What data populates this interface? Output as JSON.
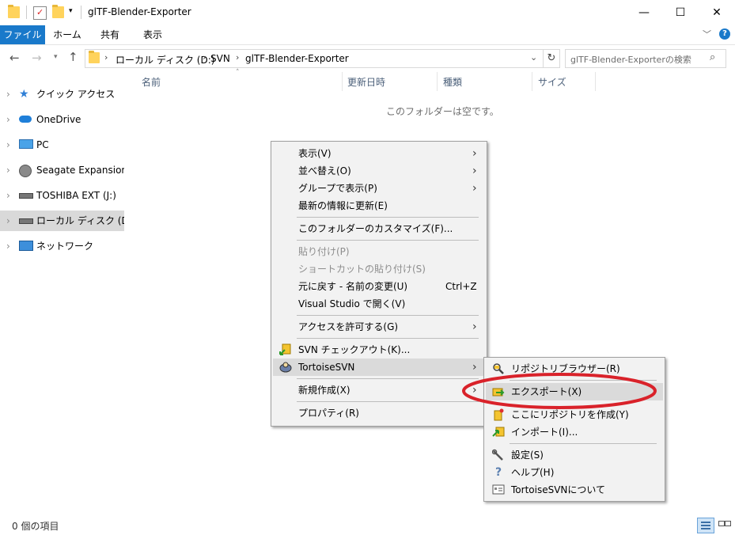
{
  "window": {
    "title": "glTF-Blender-Exporter",
    "minimize": "—",
    "maximize": "☐",
    "close": "✕"
  },
  "ribbon": {
    "tabs": [
      "ファイル",
      "ホーム",
      "共有",
      "表示"
    ],
    "accent": "#1979ca"
  },
  "address": {
    "breadcrumb": [
      "ローカル ディスク (D:)",
      "SVN",
      "glTF-Blender-Exporter"
    ],
    "search_placeholder": "glTF-Blender-Exporterの検索"
  },
  "nav": {
    "items": [
      {
        "label": "クイック アクセス",
        "icon": "star-icon"
      },
      {
        "label": "OneDrive",
        "icon": "cloud-icon"
      },
      {
        "label": "PC",
        "icon": "monitor-icon"
      },
      {
        "label": "Seagate Expansion Drive",
        "icon": "drive-icon"
      },
      {
        "label": "TOSHIBA EXT (J:)",
        "icon": "usb-drive-icon"
      },
      {
        "label": "ローカル ディスク (D:)",
        "icon": "disk-icon",
        "selected": true
      },
      {
        "label": "ネットワーク",
        "icon": "network-icon"
      }
    ]
  },
  "columns": [
    "名前",
    "更新日時",
    "種類",
    "サイズ"
  ],
  "empty_message": "このフォルダーは空です。",
  "status": {
    "count": "0 個の項目"
  },
  "context_menu": {
    "items": [
      {
        "label": "表示(V)",
        "submenu": true
      },
      {
        "label": "並べ替え(O)",
        "submenu": true
      },
      {
        "label": "グループで表示(P)",
        "submenu": true
      },
      {
        "label": "最新の情報に更新(E)"
      },
      {
        "label": "このフォルダーのカスタマイズ(F)..."
      },
      {
        "label": "貼り付け(P)",
        "disabled": true
      },
      {
        "label": "ショートカットの貼り付け(S)",
        "disabled": true
      },
      {
        "label": "元に戻す - 名前の変更(U)",
        "shortcut": "Ctrl+Z"
      },
      {
        "label": "Visual Studio で開く(V)"
      },
      {
        "label": "アクセスを許可する(G)",
        "submenu": true
      },
      {
        "label": "SVN チェックアウト(K)...",
        "icon": "svn-checkout-icon"
      },
      {
        "label": "TortoiseSVN",
        "icon": "tortoise-icon",
        "submenu": true,
        "highlighted": true
      },
      {
        "label": "新規作成(X)",
        "submenu": true
      },
      {
        "label": "プロパティ(R)"
      }
    ]
  },
  "submenu": {
    "items": [
      {
        "label": "リポジトリブラウザー(R)",
        "icon": "repo-browser-icon"
      },
      {
        "label": "エクスポート(X)",
        "icon": "export-icon",
        "highlighted": true
      },
      {
        "label": "ここにリポジトリを作成(Y)",
        "icon": "create-repo-icon"
      },
      {
        "label": "インポート(I)...",
        "icon": "import-icon"
      },
      {
        "label": "設定(S)",
        "icon": "settings-icon"
      },
      {
        "label": "ヘルプ(H)",
        "icon": "help-icon"
      },
      {
        "label": "TortoiseSVNについて",
        "icon": "about-icon"
      }
    ]
  },
  "annotation": {
    "color": "#d9222a"
  }
}
